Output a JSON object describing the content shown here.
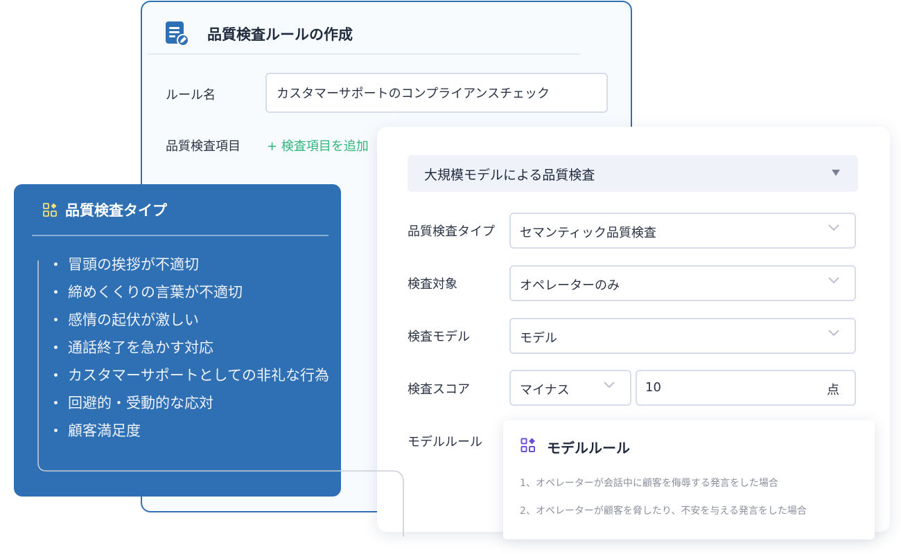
{
  "create_panel": {
    "title": "品質検査ルールの作成",
    "rule_name_label": "ルール名",
    "rule_name_value": "カスタマーサポートのコンプライアンスチェック",
    "items_label": "品質検査項目",
    "add_item": "+ 検査項目を追加"
  },
  "config_panel": {
    "method": "大規模モデルによる品質検査",
    "fields": {
      "type_label": "品質検査タイプ",
      "type_value": "セマンティック品質検査",
      "target_label": "検査対象",
      "target_value": "オペレーターのみ",
      "model_label": "検査モデル",
      "model_value": "モデル",
      "score_label": "検査スコア",
      "score_sign": "マイナス",
      "score_value": "10",
      "score_unit": "点",
      "model_rule_label": "モデルルール"
    }
  },
  "model_rule_card": {
    "title": "モデルルール",
    "rules": [
      "1、オペレーターが会話中に顧客を侮辱する発言をした場合",
      "2、オペレーターが顧客を脅したり、不安を与える発言をした場合"
    ]
  },
  "type_panel": {
    "title": "品質検査タイプ",
    "items": [
      "冒頭の挨拶が不適切",
      "締めくくりの言葉が不適切",
      "感情の起伏が激しい",
      "通話終了を急かす対応",
      "カスタマーサポートとしての非礼な行為",
      "回避的・受動的な応対",
      "顧客満足度"
    ]
  },
  "colors": {
    "accent_blue": "#2f6fb3",
    "add_green": "#2fb57a",
    "model_icon_purple": "#6b4fd8",
    "type_icon_yellow": "#f4e27a"
  }
}
